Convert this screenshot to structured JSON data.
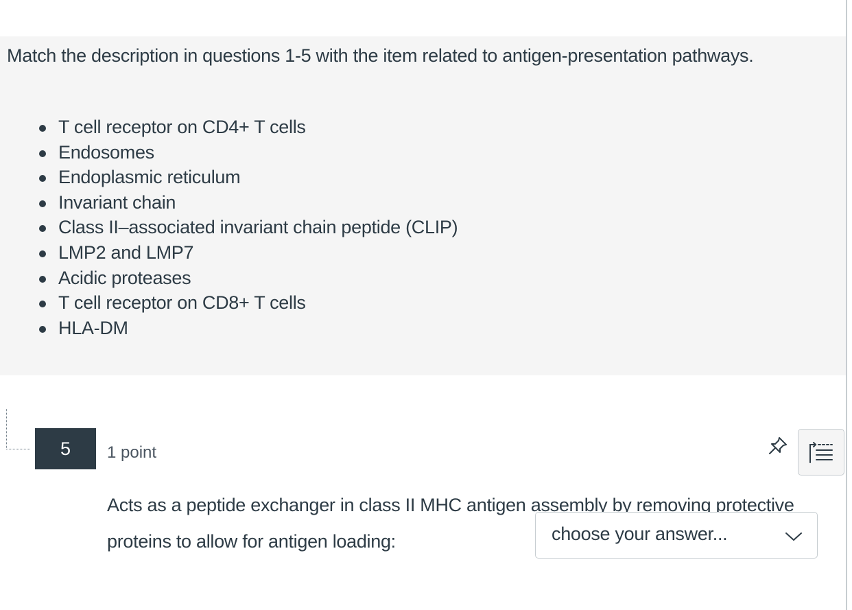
{
  "stimulus": {
    "intro": "Match the description in questions 1-5 with the item related to antigen-presentation pathways.",
    "items": [
      "T cell receptor on CD4+ T cells",
      "Endosomes",
      "Endoplasmic reticulum",
      "Invariant chain",
      "Class II–associated invariant chain peptide (CLIP)",
      "LMP2 and LMP7",
      "Acidic proteases",
      "T cell receptor on CD8+ T cells",
      "HLA-DM"
    ]
  },
  "question": {
    "number": "5",
    "points": "1 point",
    "text": "Acts as a peptide exchanger in class II MHC antigen assembly by removing protective proteins to allow for antigen loading:",
    "answer_select": {
      "value": "choose your answer..."
    },
    "icons": {
      "pin": "pin-icon",
      "toc": "list-indent-icon"
    }
  },
  "colors": {
    "text": "#2d3b45",
    "stimulus_bg": "#f5f5f5",
    "badge_bg": "#2d3b45",
    "border": "#c7cdd1"
  }
}
